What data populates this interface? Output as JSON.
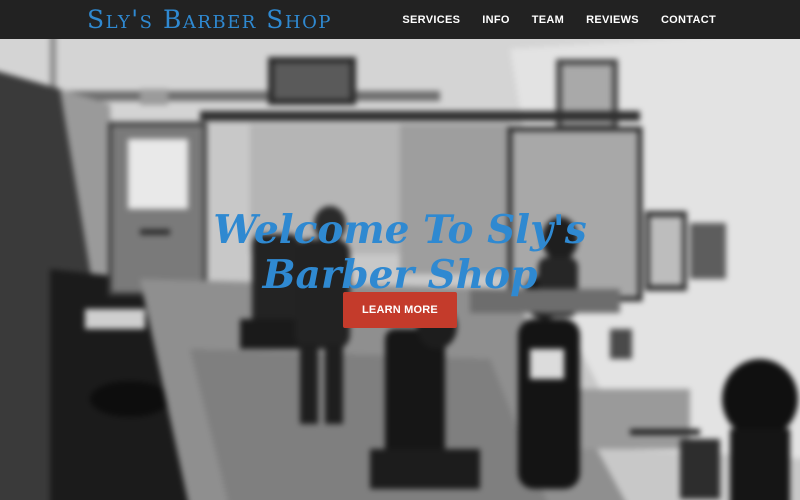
{
  "brand": {
    "logo_text": "Sly's Barber Shop",
    "accent_color": "#2f89d1",
    "navbar_color": "#222222"
  },
  "nav": {
    "items": [
      {
        "label": "SERVICES"
      },
      {
        "label": "INFO"
      },
      {
        "label": "TEAM"
      },
      {
        "label": "REVIEWS"
      },
      {
        "label": "CONTACT"
      }
    ]
  },
  "hero": {
    "title_line1": "Welcome To Sly's",
    "title_line2": "Barber Shop",
    "cta_label": "LEARN MORE",
    "cta_color": "#c43b2b",
    "background_image": "blurred-grayscale-barber-shop-interior"
  }
}
